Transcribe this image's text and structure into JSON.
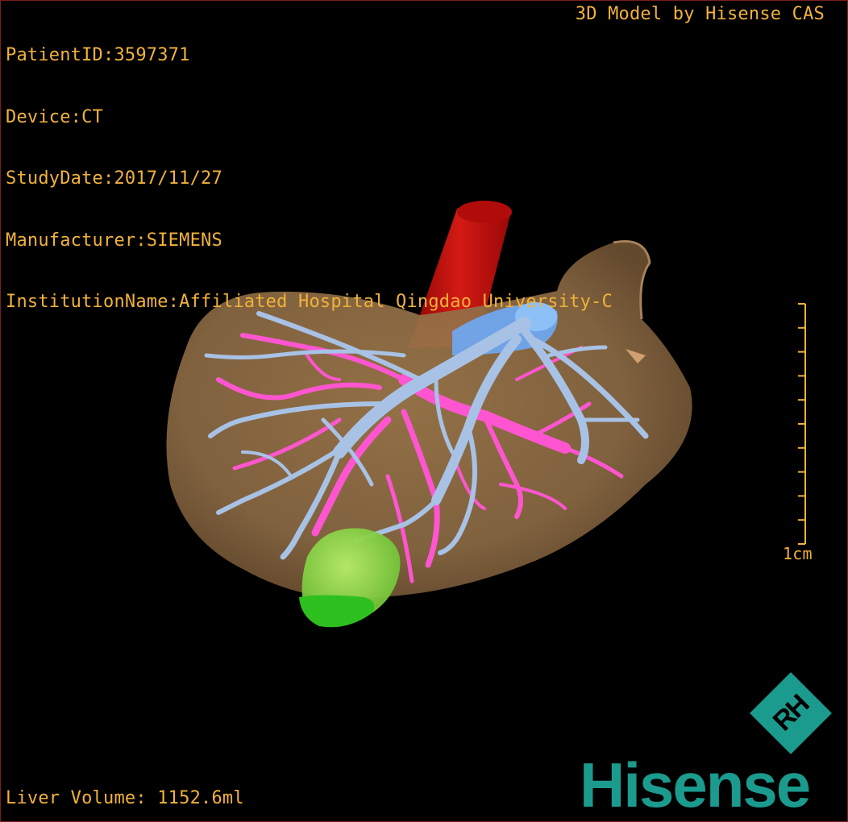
{
  "overlay": {
    "patient_id": "PatientID:3597371",
    "device": "Device:CT",
    "study_date": "StudyDate:2017/11/27",
    "manufacturer": "Manufacturer:SIEMENS",
    "institution": "InstitutionName:Affiliated Hospital Qingdao University-C",
    "model_credit": "3D Model by Hisense CAS",
    "liver_volume": "Liver Volume: 1152.6ml"
  },
  "scale_bar": {
    "label": "1cm",
    "tick_count": 11
  },
  "brand": {
    "wordmark": "Hisense",
    "logo_letters": "RH"
  },
  "colors": {
    "overlay_text": "#f2b23a",
    "liver": "#8b6a44",
    "aorta": "#c3120f",
    "portal_vein": "#a8c2e6",
    "hepatic_vessels": "#ff55d0",
    "ivc": "#6fa6ee",
    "gallbladder": "#7ad43a",
    "brand": "#1b9a8e"
  }
}
